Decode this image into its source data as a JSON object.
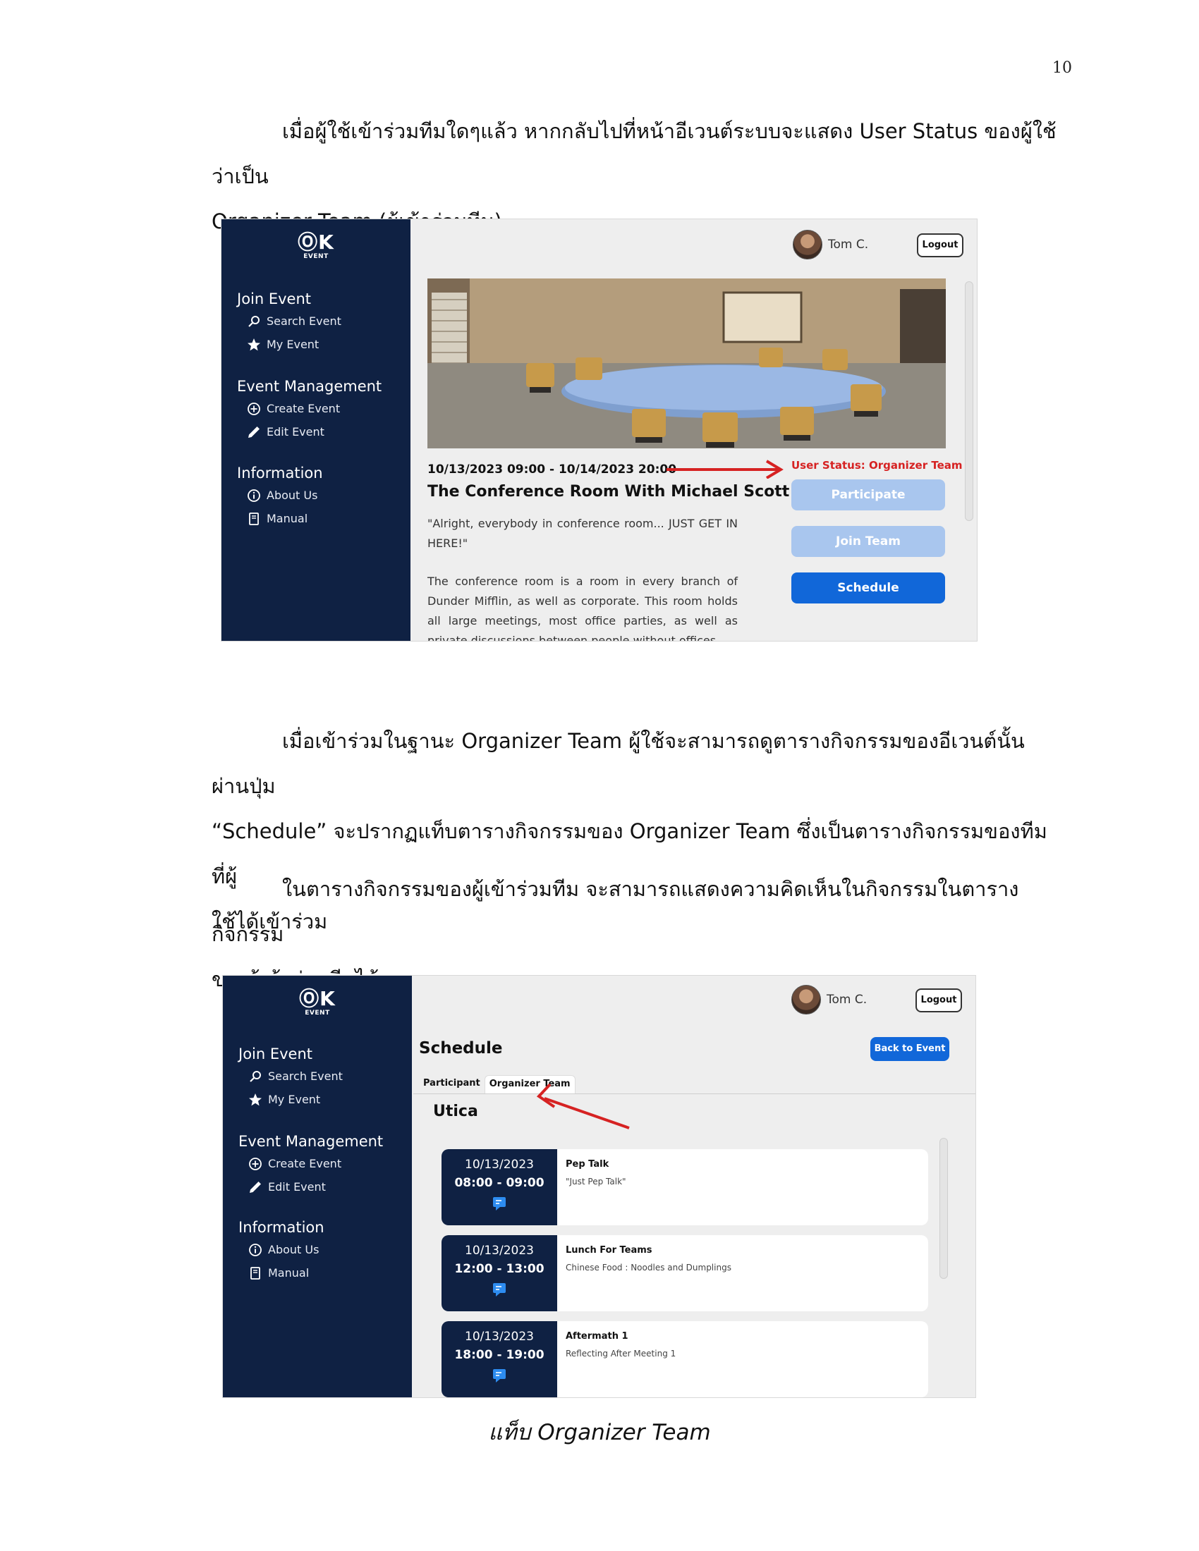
{
  "page_number": "10",
  "paragraphs": {
    "p1_line1": "เมื่อผู้ใช้เข้าร่วมทีมใดๆแล้ว หากกลับไปที่หน้าอีเวนต์ระบบจะแสดง User Status ของผู้ใช้ว่าเป็น",
    "p1_line2": "Organizer Team (ผู้เข้าร่วมทีม)",
    "p2_line1": "เมื่อเข้าร่วมในฐานะ Organizer Team ผู้ใช้จะสามารถดูตารางกิจกรรมของอีเวนต์นั้นผ่านปุ่ม",
    "p2_line2": "“Schedule” จะปรากฏแท็บตารางกิจกรรมของ Organizer Team ซึ่งเป็นตารางกิจกรรมของทีมที่ผู้",
    "p2_line3": "ใช้ได้เข้าร่วม",
    "p3_line1": "ในตารางกิจกรรมของผู้เข้าร่วมทีม จะสามารถแสดงความคิดเห็นในกิจกรรมในตารางกิจกรรม",
    "p3_line2": "ของผู้เข้าร่วมทีมได้"
  },
  "caption": "แท็บ Organizer Team",
  "app": {
    "logo_mark": "ⓄK",
    "logo_sub": "EVENT",
    "user_name": "Tom C.",
    "logout_label": "Logout",
    "nav": {
      "join_event": "Join Event",
      "search_event": "Search Event",
      "my_event": "My Event",
      "event_management": "Event Management",
      "create_event": "Create Event",
      "edit_event": "Edit Event",
      "information": "Information",
      "about_us": "About Us",
      "manual": "Manual"
    }
  },
  "event_page": {
    "date_range": "10/13/2023 09:00 - 10/14/2023 20:00",
    "title": "The Conference Room With Michael Scott",
    "quote": "\"Alright, everybody in conference room... JUST GET IN HERE!\"",
    "description": "The conference room is a room in every branch of Dunder Mifflin, as well as corporate. This room holds all large meetings, most office parties, as well as private discussions between people without offices.",
    "user_status": "User Status: Organizer Team",
    "participate_label": "Participate",
    "join_team_label": "Join Team",
    "schedule_label": "Schedule"
  },
  "schedule_page": {
    "title": "Schedule",
    "back_label": "Back to Event",
    "tabs": [
      "Participant",
      "Organizer Team"
    ],
    "team_name": "Utica",
    "items": [
      {
        "date": "10/13/2023",
        "time": "08:00 - 09:00",
        "name": "Pep Talk",
        "desc": "\"Just Pep Talk\""
      },
      {
        "date": "10/13/2023",
        "time": "12:00 - 13:00",
        "name": "Lunch For Teams",
        "desc": "Chinese Food : Noodles and Dumplings"
      },
      {
        "date": "10/13/2023",
        "time": "18:00 - 19:00",
        "name": "Aftermath 1",
        "desc": "Reflecting After Meeting 1"
      }
    ]
  },
  "colors": {
    "sidebar": "#0f2143",
    "primary_button": "#1167d9",
    "disabled_button": "#a9c6ee",
    "annotation_arrow": "#d62222"
  }
}
